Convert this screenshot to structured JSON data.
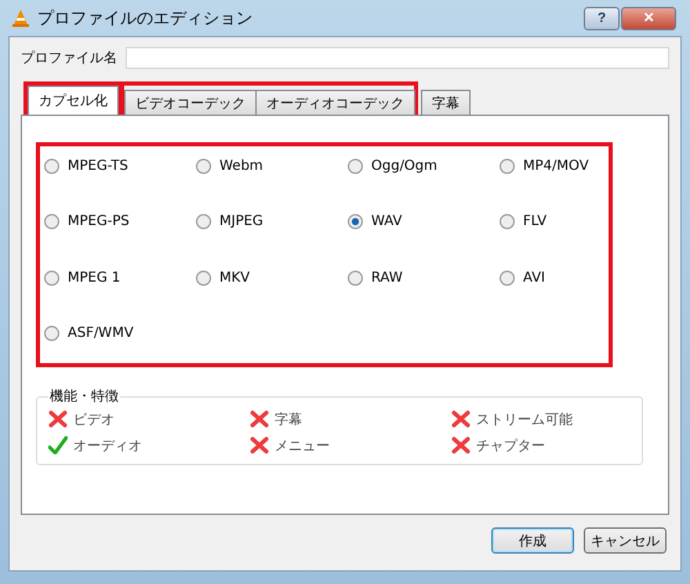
{
  "window": {
    "title": "プロファイルのエディション",
    "buttons": [
      {
        "kind": "help",
        "label": "?"
      },
      {
        "kind": "close",
        "label": "✕"
      }
    ]
  },
  "profile_name": {
    "label": "プロファイル名"
  },
  "tab_groups": [
    {
      "highlighted": true,
      "tabs": [
        {
          "label": "カプセル化",
          "selected": true
        }
      ]
    },
    {
      "highlighted": true,
      "tabs": [
        {
          "label": "ビデオコーデック",
          "selected": false
        },
        {
          "label": "オーディオコーデック",
          "selected": false
        }
      ]
    },
    {
      "highlighted": false,
      "tabs": [
        {
          "label": "字幕",
          "selected": false
        }
      ]
    }
  ],
  "formats": {
    "highlighted": true,
    "options": [
      {
        "label": "MPEG-TS",
        "selected": false
      },
      {
        "label": "Webm",
        "selected": false
      },
      {
        "label": "Ogg/Ogm",
        "selected": false
      },
      {
        "label": "MP4/MOV",
        "selected": false
      },
      {
        "label": "MPEG-PS",
        "selected": false
      },
      {
        "label": "MJPEG",
        "selected": false
      },
      {
        "label": "WAV",
        "selected": true
      },
      {
        "label": "FLV",
        "selected": false
      },
      {
        "label": "MPEG 1",
        "selected": false
      },
      {
        "label": "MKV",
        "selected": false
      },
      {
        "label": "RAW",
        "selected": false
      },
      {
        "label": "AVI",
        "selected": false
      },
      {
        "label": "ASF/WMV",
        "selected": false
      }
    ]
  },
  "features": {
    "title": "機能・特徴",
    "items": [
      {
        "label": "ビデオ",
        "supported": false
      },
      {
        "label": "字幕",
        "supported": false
      },
      {
        "label": "ストリーム可能",
        "supported": false
      },
      {
        "label": "オーディオ",
        "supported": true
      },
      {
        "label": "メニュー",
        "supported": false
      },
      {
        "label": "チャプター",
        "supported": false
      }
    ]
  },
  "buttons": [
    {
      "label": "作成",
      "default": true
    },
    {
      "label": "キャンセル",
      "default": false
    }
  ]
}
